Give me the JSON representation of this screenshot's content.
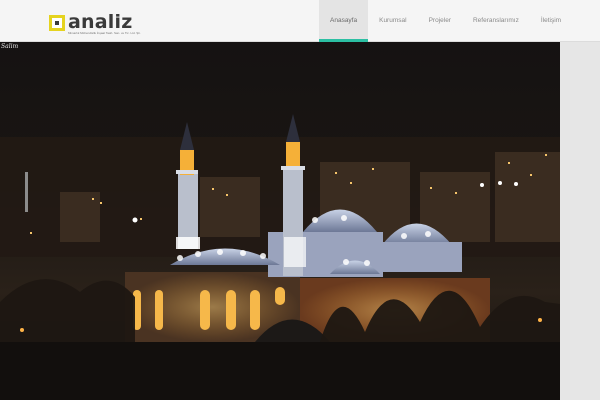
{
  "brand": {
    "logo_text": "analiz",
    "logo_tagline": "Mimarlık Mühendislik İnşaat Taah. San. ve Tic. Ltd. Şti."
  },
  "nav": {
    "items": [
      {
        "label": "Anasayfa"
      },
      {
        "label": "Kurumsal"
      },
      {
        "label": "Projeler"
      },
      {
        "label": "Referanslarımız"
      },
      {
        "label": "İletişim"
      }
    ],
    "active_index": 0
  },
  "hero": {
    "photo_credit": "Salim",
    "image_subject": "night-mosque-photo"
  },
  "colors": {
    "accent": "#2cbfa3",
    "logo_yellow": "#e5d31f",
    "header_bg": "#f5f5f5"
  }
}
